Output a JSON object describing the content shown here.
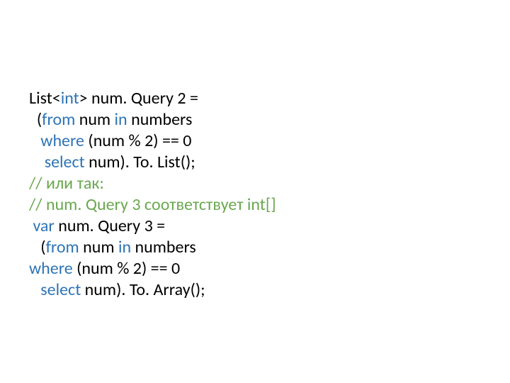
{
  "code": {
    "l1a": "List<",
    "l1b": "int",
    "l1c": "> num. Query 2 = ",
    "l2a": "  (",
    "l2b": "from",
    "l2c": " num ",
    "l2d": "in",
    "l2e": " numbers ",
    "l3a": "   ",
    "l3b": "where",
    "l3c": " (num % 2) == 0 ",
    "l4a": "    ",
    "l4b": "select",
    "l4c": " num). To. List(); ",
    "l5": "// или так:",
    "l6": "// num. Query 3 соответствует int[]",
    "l7a": " ",
    "l7b": "var",
    "l7c": " num. Query 3 = ",
    "l8a": "   (",
    "l8b": "from",
    "l8c": " num ",
    "l8d": "in",
    "l8e": " numbers ",
    "l9a": "",
    "l9b": "where",
    "l9c": " (num % 2) == 0 ",
    "l10a": "   ",
    "l10b": "select",
    "l10c": " num). To. Array(); "
  }
}
